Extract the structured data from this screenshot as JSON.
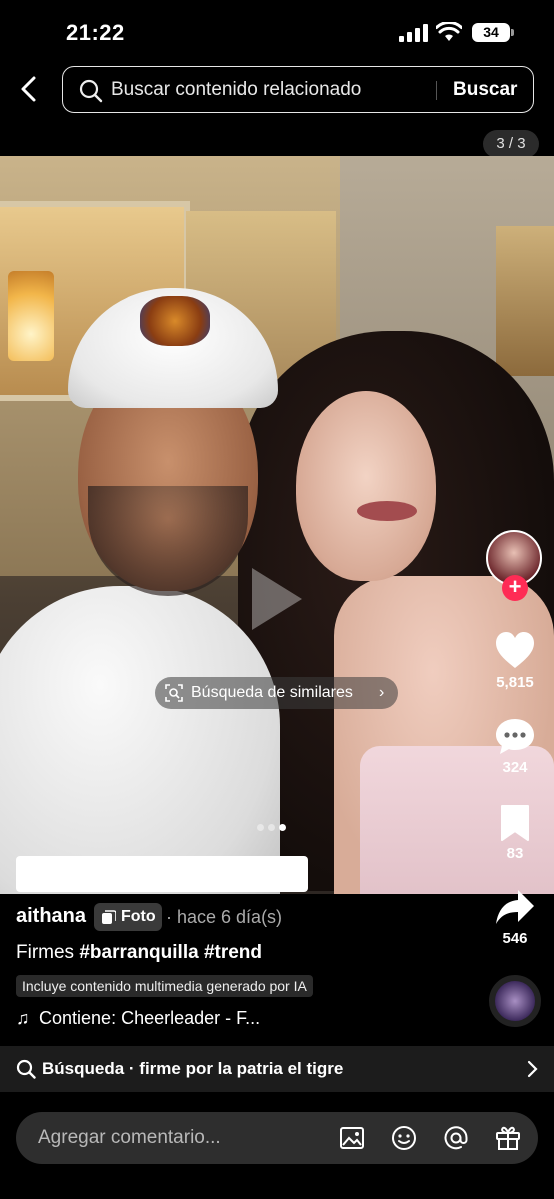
{
  "status_bar": {
    "time": "21:22",
    "battery": "34"
  },
  "search": {
    "placeholder": "Buscar contenido relacionado",
    "button_label": "Buscar"
  },
  "photo_counter": "3 / 3",
  "similar_search_label": "Búsqueda de similares",
  "carousel": {
    "total": 3,
    "active_index": 3
  },
  "rail": {
    "likes": "5,815",
    "comments": "324",
    "saves": "83",
    "shares": "546"
  },
  "post": {
    "author": "aithana",
    "type_tag": "Foto",
    "timestamp": "· hace 6 día(s)",
    "caption_text": "Firmes",
    "hashtags": "#barranquilla #trend",
    "ai_label": "Incluye contenido multimedia generado por IA",
    "music": "Contiene: Cheerleader - F..."
  },
  "related_search": {
    "label": "Búsqueda · firme por la patria el tigre"
  },
  "comment_bar": {
    "placeholder": "Agregar comentario..."
  },
  "colors": {
    "follow": "#fe2c55",
    "background": "#000000"
  },
  "icons": [
    "back-icon",
    "search-icon",
    "similar-search-icon",
    "heart-icon",
    "comment-icon",
    "bookmark-icon",
    "share-icon",
    "music-note-icon",
    "image-icon",
    "emoji-icon",
    "mention-icon",
    "gift-icon"
  ]
}
